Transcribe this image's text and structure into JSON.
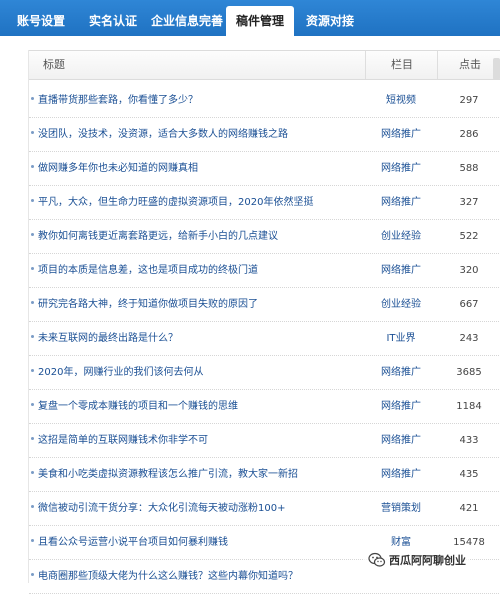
{
  "tabs": [
    {
      "label": "账号设置",
      "active": false
    },
    {
      "label": "实名认证",
      "active": false
    },
    {
      "label": "企业信息完善",
      "active": false
    },
    {
      "label": "稿件管理",
      "active": true
    },
    {
      "label": "资源对接",
      "active": false
    }
  ],
  "table": {
    "headers": {
      "title": "标题",
      "category": "栏目",
      "clicks": "点击"
    },
    "rows": [
      {
        "title": "直播带货那些套路，你看懂了多少？",
        "category": "短视频",
        "clicks": "297"
      },
      {
        "title": "没团队，没技术，没资源，适合大多数人的网络赚钱之路",
        "category": "网络推广",
        "clicks": "286"
      },
      {
        "title": "做网赚多年你也未必知道的网赚真相",
        "category": "网络推广",
        "clicks": "588"
      },
      {
        "title": "平凡，大众，但生命力旺盛的虚拟资源项目，2020年依然坚挺",
        "category": "网络推广",
        "clicks": "327"
      },
      {
        "title": "教你如何离钱更近离套路更远，给新手小白的几点建议",
        "category": "创业经验",
        "clicks": "522"
      },
      {
        "title": "项目的本质是信息差，这也是项目成功的终极门道",
        "category": "网络推广",
        "clicks": "320"
      },
      {
        "title": "研究完各路大神，终于知道你做项目失败的原因了",
        "category": "创业经验",
        "clicks": "667"
      },
      {
        "title": "未来互联网的最终出路是什么？",
        "category": "IT业界",
        "clicks": "243"
      },
      {
        "title": "2020年，网赚行业的我们该何去何从",
        "category": "网络推广",
        "clicks": "3685"
      },
      {
        "title": "复盘一个零成本赚钱的项目和一个赚钱的思维",
        "category": "网络推广",
        "clicks": "1184"
      },
      {
        "title": "这招是简单的互联网赚钱术你非学不可",
        "category": "网络推广",
        "clicks": "433"
      },
      {
        "title": "美食和小吃类虚拟资源教程该怎么推广引流，教大家一新招",
        "category": "网络推广",
        "clicks": "435"
      },
      {
        "title": "微信被动引流干货分享：大众化引流每天被动涨粉100+",
        "category": "营销策划",
        "clicks": "421"
      },
      {
        "title": "且看公众号运营小说平台项目如何暴利赚钱",
        "category": "财富",
        "clicks": "15478"
      },
      {
        "title": "电商圈那些顶级大佬为什么这么赚钱？这些内幕你知道吗？",
        "category": "",
        "clicks": ""
      }
    ]
  },
  "watermark": {
    "text": "西瓜阿阿聊创业",
    "icon": "wechat-icon"
  },
  "colors": {
    "tabbar": "#2f86d6",
    "link": "#1a4f94"
  }
}
